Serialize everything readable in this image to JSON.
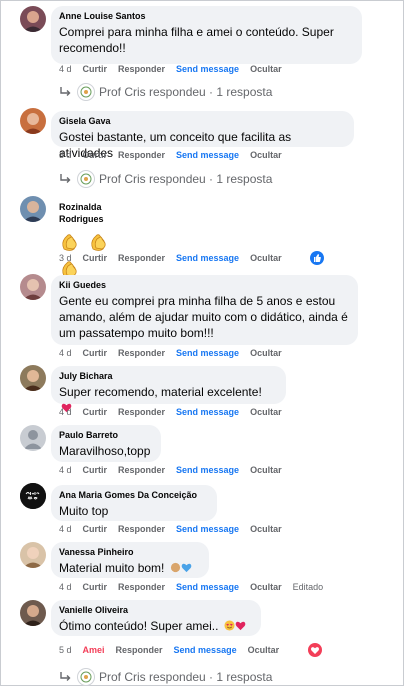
{
  "comments": [
    {
      "name": "Anne Louise Santos",
      "text": "Comprei para minha filha e amei o conteúdo. Super recomendo!!",
      "time": "4 d",
      "like": "Curtir",
      "reply": "Responder",
      "send": "Send message",
      "hide": "Ocultar"
    },
    {
      "name": "Gisela Gava",
      "text": "Gostei bastante, um conceito que facilita as atividades",
      "time": "3 d",
      "like": "Curtir",
      "reply": "Responder",
      "send": "Send message",
      "hide": "Ocultar"
    },
    {
      "name": "Rozinalda Rodrigues",
      "text": "",
      "time": "3 d",
      "like": "Curtir",
      "reply": "Responder",
      "send": "Send message",
      "hide": "Ocultar"
    },
    {
      "name": "Kii Guedes",
      "text": "Gente eu comprei pra minha filha de 5 anos e estou amando, além de ajudar muito com o didático, ainda é um passatempo muito bom!!!",
      "time": "4 d",
      "like": "Curtir",
      "reply": "Responder",
      "send": "Send message",
      "hide": "Ocultar"
    },
    {
      "name": "July Bichara",
      "text": "Super recomendo, material excelente!",
      "time": "4 d",
      "like": "Curtir",
      "reply": "Responder",
      "send": "Send message",
      "hide": "Ocultar"
    },
    {
      "name": "Paulo Barreto",
      "text": "Maravilhoso,topp",
      "time": "4 d",
      "like": "Curtir",
      "reply": "Responder",
      "send": "Send message",
      "hide": "Ocultar"
    },
    {
      "name": "Ana Maria Gomes Da Conceição",
      "text": "Muito top",
      "time": "4 d",
      "like": "Curtir",
      "reply": "Responder",
      "send": "Send message",
      "hide": "Ocultar"
    },
    {
      "name": "Vanessa Pinheiro",
      "text": "Material muito bom!",
      "time": "4 d",
      "like": "Curtir",
      "reply": "Responder",
      "send": "Send message",
      "hide": "Ocultar",
      "edited": "Editado"
    },
    {
      "name": "Vanielle Oliveira",
      "text": "Ótimo conteúdo! Super amei..",
      "time": "5 d",
      "like": "Amei",
      "reply": "Responder",
      "send": "Send message",
      "hide": "Ocultar"
    }
  ],
  "replies": [
    {
      "text": "Prof Cris respondeu · 1 resposta"
    },
    {
      "text": "Prof Cris respondeu · 1 resposta"
    },
    {
      "text": "Prof Cris respondeu · 1 resposta"
    }
  ],
  "avatar_logo_text": "Luto Mãe",
  "colors": {
    "bubble": "#f0f2f5",
    "link": "#1877f2",
    "meta": "#65676b",
    "love": "#f33e58"
  }
}
